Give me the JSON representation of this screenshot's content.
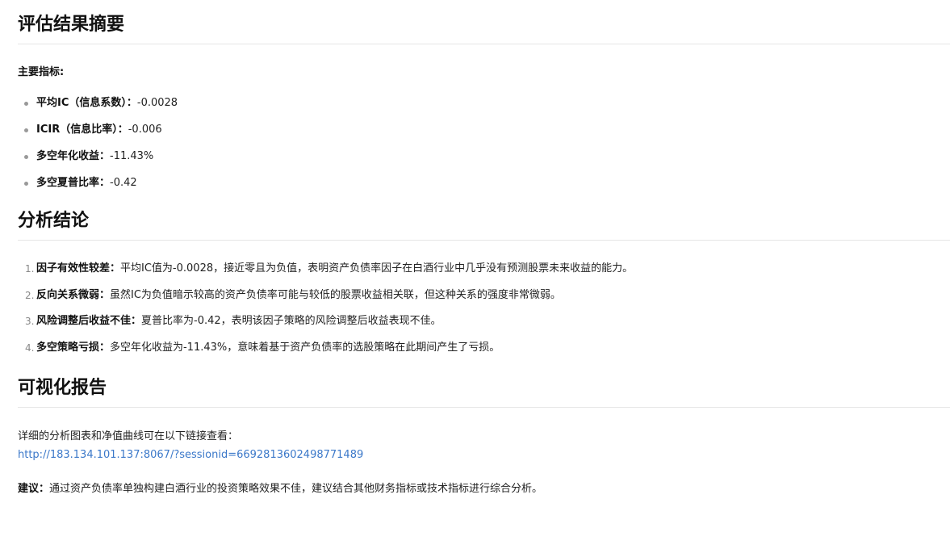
{
  "section_summary": {
    "title": "评估结果摘要",
    "metrics_label": "主要指标:",
    "metrics": [
      {
        "label": "平均IC（信息系数）：",
        "value": "-0.0028"
      },
      {
        "label": "ICIR（信息比率）：",
        "value": "-0.006"
      },
      {
        "label": "多空年化收益：",
        "value": "-11.43%"
      },
      {
        "label": "多空夏普比率：",
        "value": "-0.42"
      }
    ]
  },
  "section_conclusion": {
    "title": "分析结论",
    "items": [
      {
        "number": "1.",
        "label": "因子有效性较差：",
        "text": "平均IC值为-0.0028，接近零且为负值，表明资产负债率因子在白酒行业中几乎没有预测股票未来收益的能力。"
      },
      {
        "number": "2.",
        "label": "反向关系微弱：",
        "text": "虽然IC为负值暗示较高的资产负债率可能与较低的股票收益相关联，但这种关系的强度非常微弱。"
      },
      {
        "number": "3.",
        "label": "风险调整后收益不佳：",
        "text": "夏普比率为-0.42，表明该因子策略的风险调整后收益表现不佳。"
      },
      {
        "number": "4.",
        "label": "多空策略亏损：",
        "text": "多空年化收益为-11.43%，意味着基于资产负债率的选股策略在此期间产生了亏损。"
      }
    ]
  },
  "section_report": {
    "title": "可视化报告",
    "intro": "详细的分析图表和净值曲线可在以下链接查看：",
    "link": "http://183.134.101.137:8067/?sessionid=6692813602498771489",
    "advice_label": "建议：",
    "advice_text": "通过资产负债率单独构建白酒行业的投资策略效果不佳，建议结合其他财务指标或技术指标进行综合分析。"
  }
}
